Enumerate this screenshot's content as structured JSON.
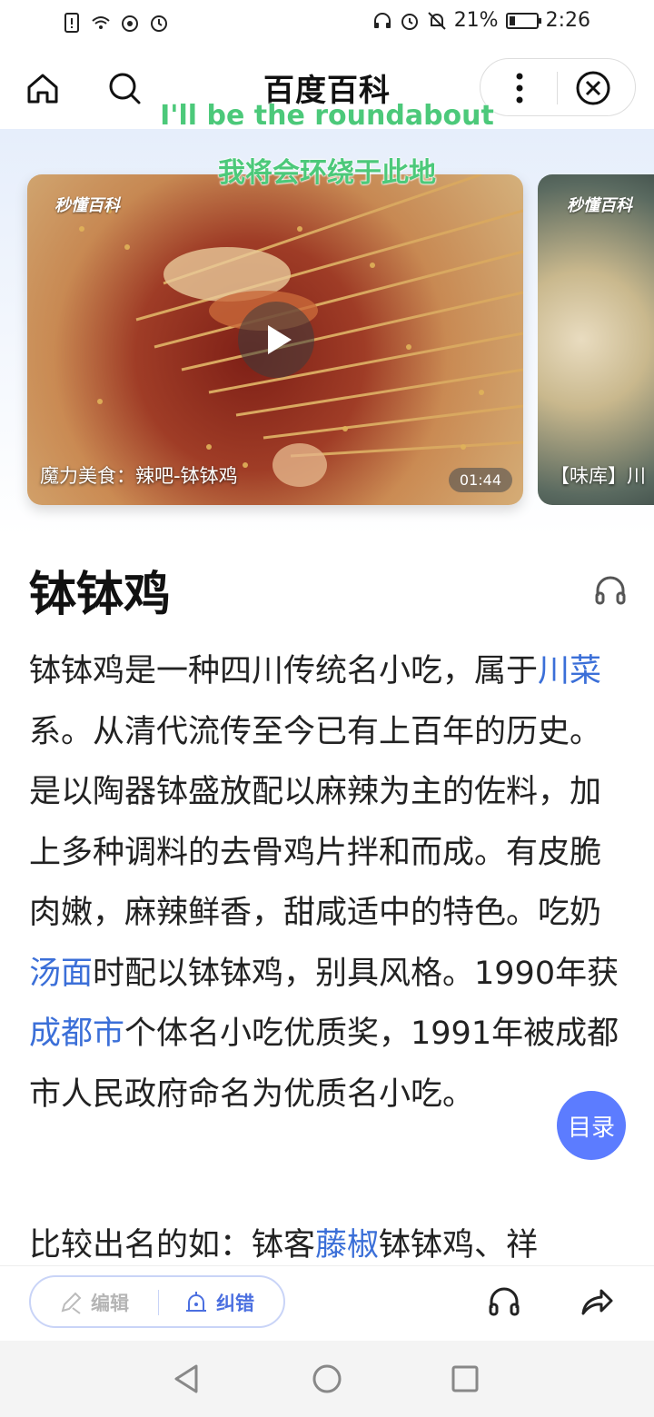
{
  "status_bar": {
    "battery": "21%",
    "battery_level": 0.21,
    "time": "2:26"
  },
  "header": {
    "title": "百度百科"
  },
  "overlay": {
    "english": "I'll be the roundabout",
    "chinese": "我将会环绕于此地"
  },
  "carousel": {
    "cards": [
      {
        "brand": "秒懂百科",
        "title": "魔力美食：辣吧-钵钵鸡",
        "duration": "01:44"
      },
      {
        "brand": "秒懂百科",
        "title": "【味库】川"
      }
    ]
  },
  "article": {
    "title": "钵钵鸡",
    "p1": {
      "t1": "钵钵鸡是一种四川传统名小吃，属于",
      "link1": "川菜",
      "t2": "系。从清代流传至今已有上百年的历史。是以陶器钵盛放配以麻辣为主的佐料，加上多种调料的去骨鸡片拌和而成。有皮脆肉嫩，麻辣鲜香，甜咸适中的特色。吃奶",
      "link2": "汤面",
      "t3": "时配以钵钵鸡，别具风格。1990年获",
      "link3": "成都市",
      "t4": "个体名小吃优质奖，1991年被成都市人民政府命名为优质名小吃。"
    },
    "p2": {
      "t1": "比较出名的如：钵客",
      "link1": "藤椒",
      "t2": "钵钵鸡、祥"
    }
  },
  "toc_label": "目录",
  "toolbar": {
    "edit_label": "编辑",
    "correct_label": "纠错"
  }
}
